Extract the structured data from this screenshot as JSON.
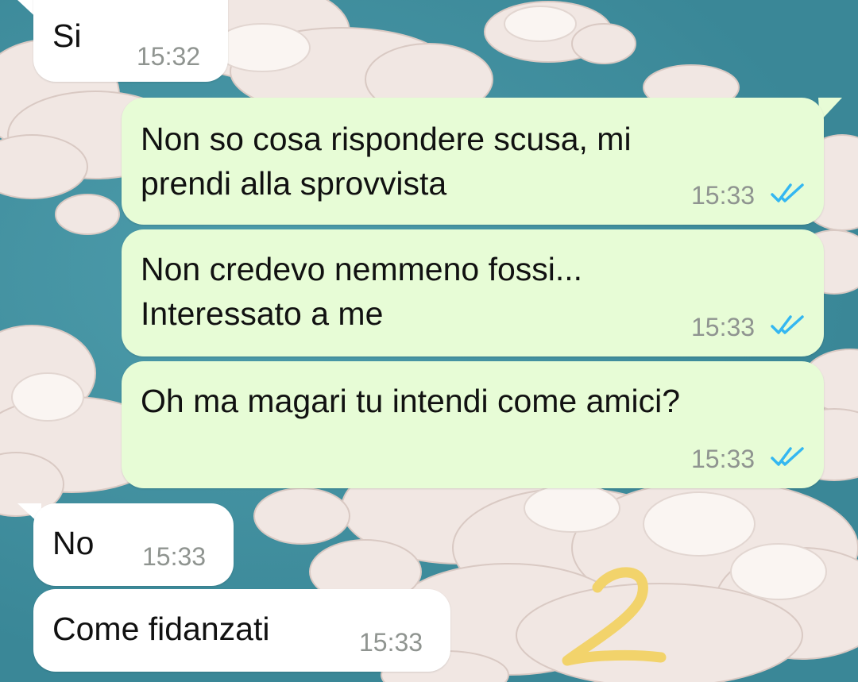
{
  "conversation": {
    "messages": [
      {
        "direction": "in",
        "text": "Si",
        "time": "15:32"
      },
      {
        "direction": "out",
        "text": "Non so cosa rispondere scusa, mi\nprendi alla sprovvista",
        "time": "15:33",
        "status": "read"
      },
      {
        "direction": "out",
        "text": "Non credevo nemmeno fossi...\nInteressato a me",
        "time": "15:33",
        "status": "read"
      },
      {
        "direction": "out",
        "text": "Oh ma magari tu intendi come amici?",
        "time": "15:33",
        "status": "read"
      },
      {
        "direction": "in",
        "text": "No",
        "time": "15:33"
      },
      {
        "direction": "in",
        "text": "Come fidanzati",
        "time": "15:33"
      }
    ]
  },
  "overlay": {
    "annotation": "2",
    "color": "#f2d36b"
  },
  "colors": {
    "incoming_bubble": "#ffffff",
    "outgoing_bubble": "#e7fcd6",
    "read_ticks": "#34b7f1",
    "timestamp": "#8f9490"
  },
  "icons": {
    "read_receipt": "double-check-icon"
  }
}
